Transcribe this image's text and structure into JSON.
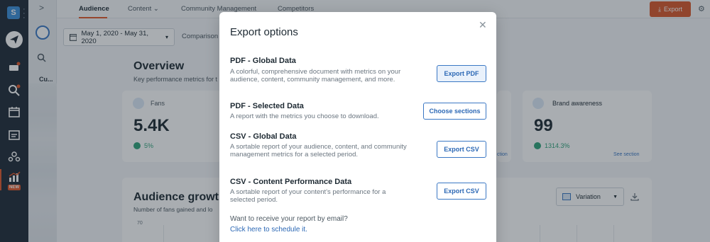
{
  "rail": {
    "workspace_initial": "S",
    "new_tag": "NEW"
  },
  "sidebar": {
    "label": "Cu..."
  },
  "tabs": [
    {
      "label": "Audience"
    },
    {
      "label": "Content"
    },
    {
      "label": "Community Management"
    },
    {
      "label": "Competitors"
    }
  ],
  "top": {
    "export_label": "Export"
  },
  "filters": {
    "date_range": "May 1, 2020 - May 31, 2020",
    "comparison_label": "Comparison"
  },
  "overview": {
    "title": "Overview",
    "subtitle": "Key performance metrics for t",
    "fans_label": "Fans",
    "fans_value": "5.4K",
    "fans_change": "5%",
    "mid_see": "ction",
    "brand_label": "Brand awareness",
    "brand_value": "99",
    "brand_change": "1314.3%",
    "brand_see": "See section"
  },
  "audience_growth": {
    "title": "Audience growth",
    "subtitle": "Number of fans gained and lo",
    "tick": "70",
    "variation_label": "Variation"
  },
  "modal": {
    "title": "Export options",
    "options": [
      {
        "title": "PDF - Global Data",
        "desc": "A colorful, comprehensive document with metrics on your audience, content, community management, and more.",
        "button": "Export PDF"
      },
      {
        "title": "PDF - Selected Data",
        "desc": "A report with the metrics you choose to download.",
        "button": "Choose sections"
      },
      {
        "title": "CSV - Global Data",
        "desc": "A sortable report of your audience, content, and community management metrics for a selected period.",
        "button": "Export CSV"
      },
      {
        "title": "CSV - Content Performance Data",
        "desc": "A sortable report of your content's performance for a selected period.",
        "button": "Export CSV"
      }
    ],
    "email_question": "Want to receive your report by email?",
    "email_link": "Click here to schedule it."
  },
  "colors": {
    "accent": "#e0572a",
    "link": "#2c68b5",
    "rail": "#202b37"
  }
}
